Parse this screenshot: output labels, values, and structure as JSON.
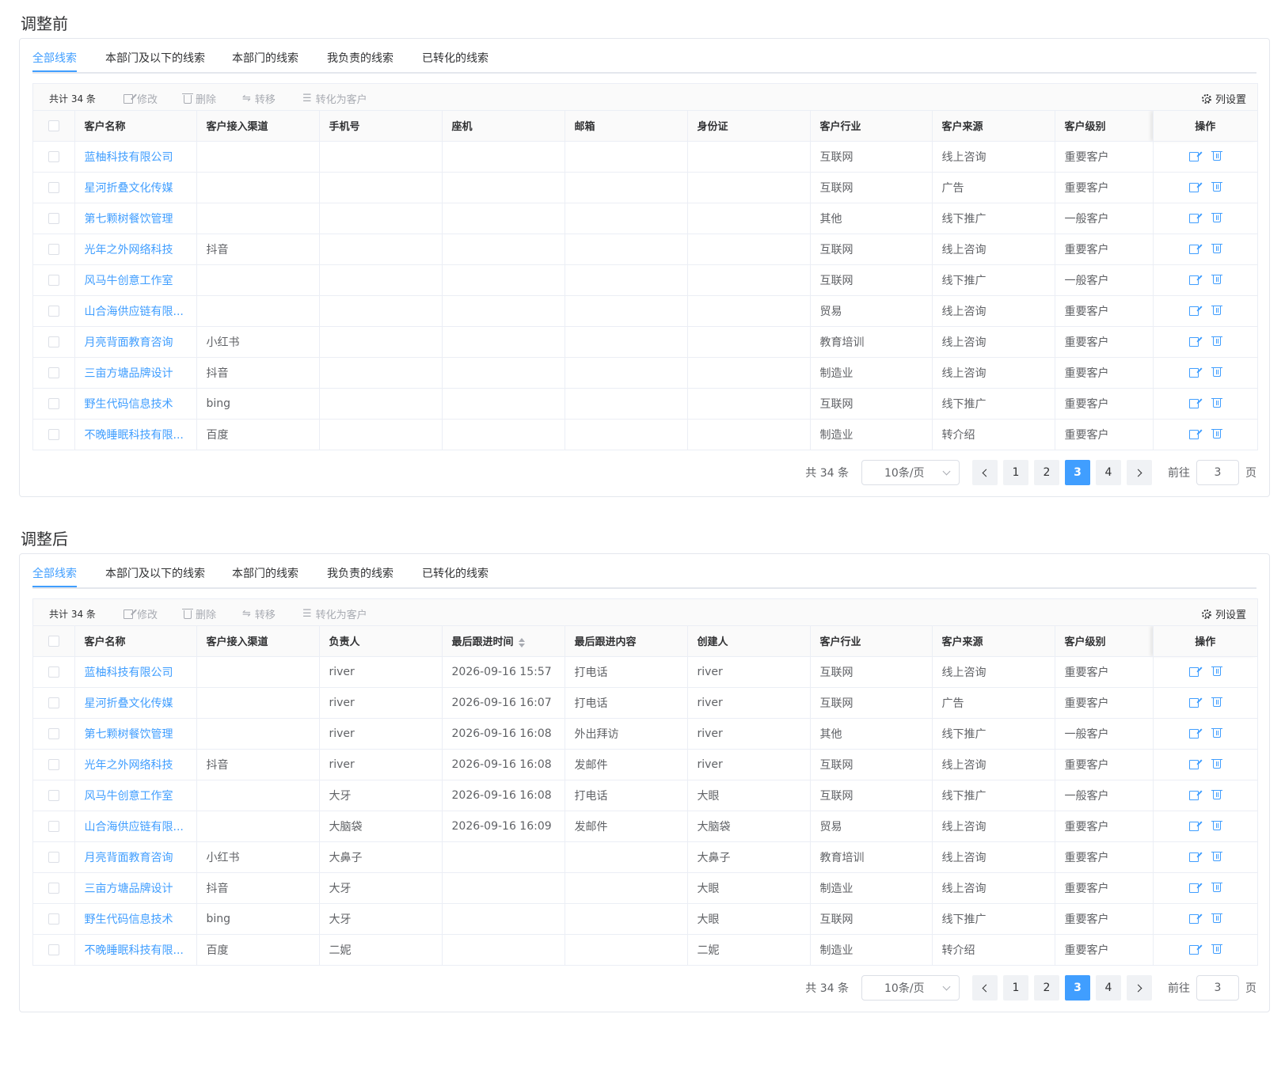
{
  "sections": {
    "before": {
      "title": "调整前",
      "tabs": [
        "全部线索",
        "本部门及以下的线索",
        "本部门的线索",
        "我负责的线索",
        "已转化的线索"
      ],
      "columns": [
        "客户名称",
        "客户接入渠道",
        "手机号",
        "座机",
        "邮箱",
        "身份证",
        "客户行业",
        "客户来源",
        "客户级别",
        "操作"
      ],
      "rows": [
        [
          "蓝柚科技有限公司",
          "",
          "",
          "",
          "",
          "",
          "互联网",
          "线上咨询",
          "重要客户"
        ],
        [
          "星河折叠文化传媒",
          "",
          "",
          "",
          "",
          "",
          "互联网",
          "广告",
          "重要客户"
        ],
        [
          "第七颗树餐饮管理",
          "",
          "",
          "",
          "",
          "",
          "其他",
          "线下推广",
          "一般客户"
        ],
        [
          "光年之外网络科技",
          "抖音",
          "",
          "",
          "",
          "",
          "互联网",
          "线上咨询",
          "重要客户"
        ],
        [
          "风马牛创意工作室",
          "",
          "",
          "",
          "",
          "",
          "互联网",
          "线下推广",
          "一般客户"
        ],
        [
          "山合海供应链有限...",
          "",
          "",
          "",
          "",
          "",
          "贸易",
          "线上咨询",
          "重要客户"
        ],
        [
          "月亮背面教育咨询",
          "小红书",
          "",
          "",
          "",
          "",
          "教育培训",
          "线上咨询",
          "重要客户"
        ],
        [
          "三亩方塘品牌设计",
          "抖音",
          "",
          "",
          "",
          "",
          "制造业",
          "线上咨询",
          "重要客户"
        ],
        [
          "野生代码信息技术",
          "bing",
          "",
          "",
          "",
          "",
          "互联网",
          "线下推广",
          "重要客户"
        ],
        [
          "不晚睡眠科技有限...",
          "百度",
          "",
          "",
          "",
          "",
          "制造业",
          "转介绍",
          "重要客户"
        ]
      ]
    },
    "after": {
      "title": "调整后",
      "tabs": [
        "全部线索",
        "本部门及以下的线索",
        "本部门的线索",
        "我负责的线索",
        "已转化的线索"
      ],
      "columns": [
        "客户名称",
        "客户接入渠道",
        "负责人",
        "最后跟进时间",
        "最后跟进内容",
        "创建人",
        "客户行业",
        "客户来源",
        "客户级别",
        "操作"
      ],
      "rows": [
        [
          "蓝柚科技有限公司",
          "",
          "river",
          "2026-09-16 15:57",
          "打电话",
          "river",
          "互联网",
          "线上咨询",
          "重要客户"
        ],
        [
          "星河折叠文化传媒",
          "",
          "river",
          "2026-09-16 16:07",
          "打电话",
          "river",
          "互联网",
          "广告",
          "重要客户"
        ],
        [
          "第七颗树餐饮管理",
          "",
          "river",
          "2026-09-16 16:08",
          "外出拜访",
          "river",
          "其他",
          "线下推广",
          "一般客户"
        ],
        [
          "光年之外网络科技",
          "抖音",
          "river",
          "2026-09-16 16:08",
          "发邮件",
          "river",
          "互联网",
          "线上咨询",
          "重要客户"
        ],
        [
          "风马牛创意工作室",
          "",
          "大牙",
          "2026-09-16 16:08",
          "打电话",
          "大眼",
          "互联网",
          "线下推广",
          "一般客户"
        ],
        [
          "山合海供应链有限...",
          "",
          "大脑袋",
          "2026-09-16 16:09",
          "发邮件",
          "大脑袋",
          "贸易",
          "线上咨询",
          "重要客户"
        ],
        [
          "月亮背面教育咨询",
          "小红书",
          "大鼻子",
          "",
          "",
          "大鼻子",
          "教育培训",
          "线上咨询",
          "重要客户"
        ],
        [
          "三亩方塘品牌设计",
          "抖音",
          "大牙",
          "",
          "",
          "大眼",
          "制造业",
          "线上咨询",
          "重要客户"
        ],
        [
          "野生代码信息技术",
          "bing",
          "大牙",
          "",
          "",
          "大眼",
          "互联网",
          "线下推广",
          "重要客户"
        ],
        [
          "不晚睡眠科技有限...",
          "百度",
          "二妮",
          "",
          "",
          "二妮",
          "制造业",
          "转介绍",
          "重要客户"
        ]
      ]
    }
  },
  "toolbar": {
    "total": "共计 34 条",
    "edit": "修改",
    "delete": "删除",
    "transfer": "转移",
    "convert": "转化为客户",
    "column_settings": "列设置"
  },
  "pager": {
    "total": "共 34 条",
    "page_size": "10条/页",
    "pages": [
      "1",
      "2",
      "3",
      "4"
    ],
    "current": "3",
    "goto_label": "前往",
    "goto_value": "3",
    "page_suffix": "页"
  },
  "colors": {
    "accent": "#409eff",
    "border": "#ebeef5",
    "header_bg": "#fafafa"
  }
}
